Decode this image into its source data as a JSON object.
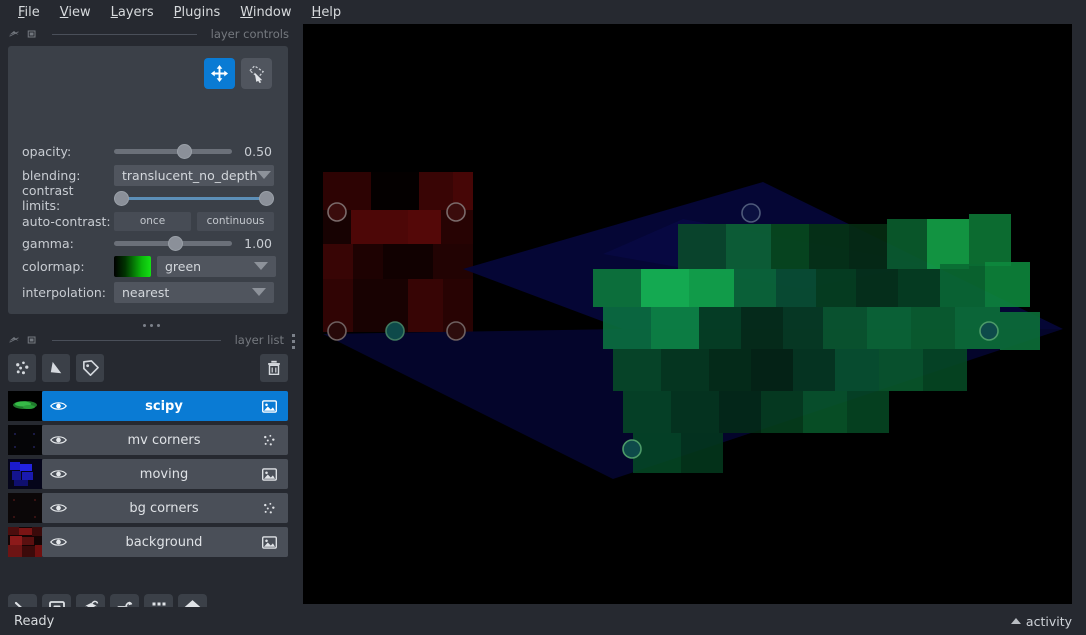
{
  "menubar": {
    "items": [
      {
        "label": "File",
        "mnemonic": "F"
      },
      {
        "label": "View",
        "mnemonic": "V"
      },
      {
        "label": "Layers",
        "mnemonic": "L"
      },
      {
        "label": "Plugins",
        "mnemonic": "P"
      },
      {
        "label": "Window",
        "mnemonic": "W"
      },
      {
        "label": "Help",
        "mnemonic": "H"
      }
    ]
  },
  "layer_controls": {
    "dock_title": "layer controls",
    "modes": [
      {
        "name": "pan-zoom",
        "active": true
      },
      {
        "name": "transform",
        "active": false
      }
    ],
    "opacity": {
      "label": "opacity:",
      "value": "0.50",
      "percent": 50
    },
    "blending": {
      "label": "blending:",
      "value": "translucent_no_depth"
    },
    "contrast_limits": {
      "label": "contrast limits:",
      "low_percent": 0,
      "high_percent": 100
    },
    "auto_contrast": {
      "label": "auto-contrast:",
      "once": "once",
      "continuous": "continuous"
    },
    "gamma": {
      "label": "gamma:",
      "value": "1.00",
      "percent": 35
    },
    "colormap": {
      "label": "colormap:",
      "value": "green"
    },
    "interpolation": {
      "label": "interpolation:",
      "value": "nearest"
    }
  },
  "layer_list": {
    "dock_title": "layer list",
    "toolbar": [
      {
        "name": "new-points-layer"
      },
      {
        "name": "new-shapes-layer"
      },
      {
        "name": "new-labels-layer"
      },
      {
        "name": "delete-layer"
      }
    ],
    "layers": [
      {
        "name": "scipy",
        "type": "image",
        "visible": true,
        "selected": true,
        "thumb": "green"
      },
      {
        "name": "mv corners",
        "type": "points",
        "visible": true,
        "selected": false,
        "thumb": "dark"
      },
      {
        "name": "moving",
        "type": "image",
        "visible": true,
        "selected": false,
        "thumb": "blue"
      },
      {
        "name": "bg corners",
        "type": "points",
        "visible": true,
        "selected": false,
        "thumb": "black"
      },
      {
        "name": "background",
        "type": "image",
        "visible": true,
        "selected": false,
        "thumb": "red"
      }
    ]
  },
  "viewer_buttons": [
    {
      "name": "console-button"
    },
    {
      "name": "ndisplay-2d-button"
    },
    {
      "name": "ndisplay-3d-button"
    },
    {
      "name": "roll-dims-button"
    },
    {
      "name": "grid-view-button"
    },
    {
      "name": "reset-view-home-button"
    }
  ],
  "statusbar": {
    "status": "Ready",
    "activity": "activity"
  },
  "colors": {
    "accent": "#0a7bd4",
    "panel": "#3b4048",
    "window": "#262930",
    "row": "#4a4f58",
    "text": "#d7dadd",
    "muted": "#75797f",
    "canvas_bg": "#000000"
  }
}
